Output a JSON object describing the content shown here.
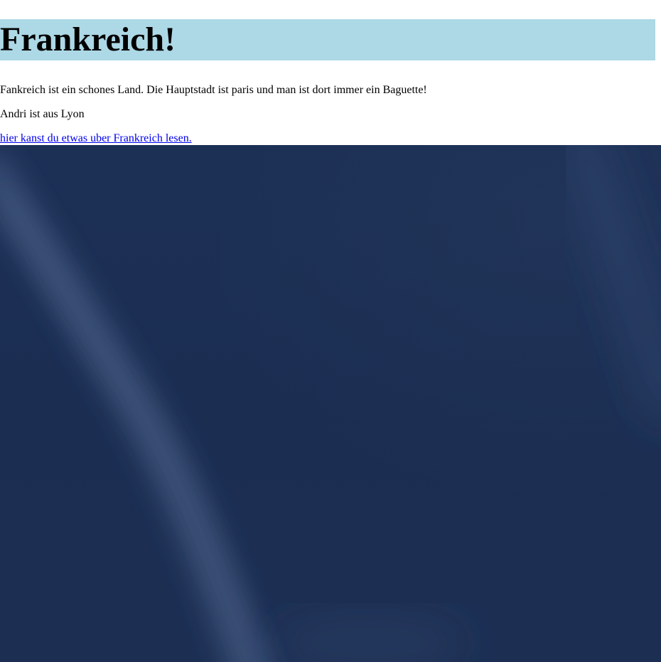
{
  "heading": {
    "title": "Frankreich!",
    "background": "#add8e6"
  },
  "paragraphs": {
    "intro": "Fankreich ist ein schones Land. Die Hauptstadt ist paris und man ist dort immer ein Baguette!",
    "person": "Andri ist aus Lyon"
  },
  "link": {
    "text": "hier kanst du etwas uber Frankreich lesen.",
    "color": "#0000ee"
  },
  "image": {
    "subject": "night-sky-with-contrail",
    "base_color": "#1c2f55"
  }
}
